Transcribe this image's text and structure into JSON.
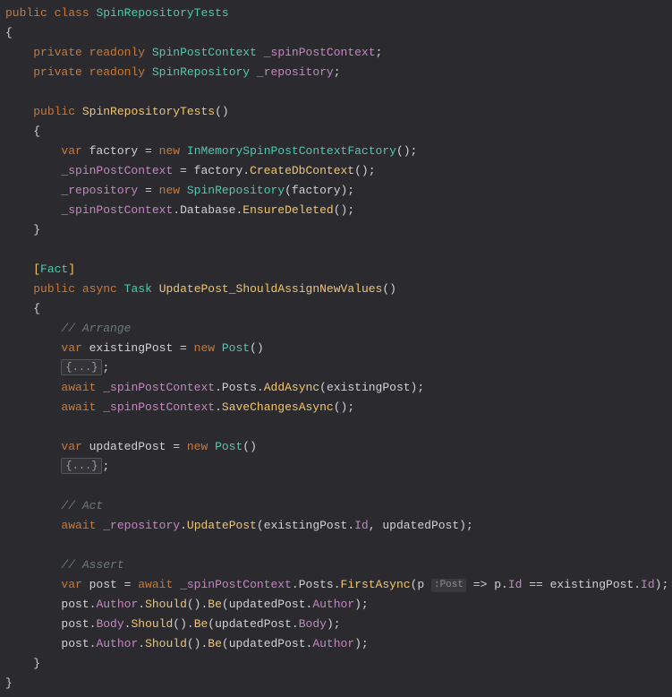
{
  "l1": {
    "kw1": "public",
    "kw2": "class",
    "name": "SpinRepositoryTests"
  },
  "l2": {
    "b": "{"
  },
  "l3": {
    "kw1": "private",
    "kw2": "readonly",
    "type": "SpinPostContext",
    "name": "_spinPostContext",
    "semi": ";"
  },
  "l4": {
    "kw1": "private",
    "kw2": "readonly",
    "type": "SpinRepository",
    "name": "_repository",
    "semi": ";"
  },
  "l5": {
    "kw": "public",
    "name": "SpinRepositoryTests",
    "paren": "()"
  },
  "l6": {
    "b": "{"
  },
  "l7": {
    "kw": "var",
    "name": " factory ",
    "eq": "=",
    "kwNew": "new",
    "type": "InMemorySpinPostContextFactory",
    "tail": "();"
  },
  "l8": {
    "fld": "_spinPostContext",
    "mid": " = factory.",
    "fn": "CreateDbContext",
    "tail": "();"
  },
  "l9": {
    "fld": "_repository",
    "mid": " = ",
    "kw": "new",
    "type": "SpinRepository",
    "tail": "(factory);"
  },
  "l10": {
    "fld": "_spinPostContext",
    "dot": ".",
    "m1": "Database",
    "dot2": ".",
    "fn": "EnsureDeleted",
    "tail": "();"
  },
  "l11": {
    "b": "}"
  },
  "l12": {
    "open": "[",
    "attr": "Fact",
    "close": "]"
  },
  "l13": {
    "kw1": "public",
    "kw2": "async",
    "type": "Task",
    "fn": "UpdatePost_ShouldAssignNewValues",
    "paren": "()"
  },
  "l14": {
    "b": "{"
  },
  "l15": {
    "c": "// Arrange"
  },
  "l16": {
    "kw": "var",
    "name": " existingPost ",
    "eq": "= ",
    "kwNew": "new",
    "type": "Post",
    "paren": "()"
  },
  "l17": {
    "fold": "{...}",
    "semi": ";"
  },
  "l18": {
    "kw": "await",
    "fld": "_spinPostContext",
    "dot": ".",
    "m": "Posts",
    "dot2": ".",
    "fn": "AddAsync",
    "tail": "(existingPost);"
  },
  "l19": {
    "kw": "await",
    "fld": "_spinPostContext",
    "dot": ".",
    "fn": "SaveChangesAsync",
    "tail": "();"
  },
  "l20": {
    "kw": "var",
    "name": " updatedPost ",
    "eq": "= ",
    "kwNew": "new",
    "type": "Post",
    "paren": "()"
  },
  "l21": {
    "fold": "{...}",
    "semi": ";"
  },
  "l22": {
    "c": "// Act"
  },
  "l23": {
    "kw": "await",
    "fld": "_repository",
    "dot": ".",
    "fn": "UpdatePost",
    "open": "(existingPost.",
    "m": "Id",
    "rest": ", updatedPost);"
  },
  "l24": {
    "c": "// Assert"
  },
  "l25": {
    "kw": "var",
    "name": " post = ",
    "kw2": "await",
    "fld": "_spinPostContext",
    "dot": ".",
    "m": "Posts",
    "dot2": ".",
    "fn": "FirstAsync",
    "open": "(p",
    "hint": ":Post",
    "rest1": " => p.",
    "pId": "Id",
    "rest2": " == existingPost.",
    "eId": "Id",
    "close": ");"
  },
  "l26": {
    "pre": "post.",
    "a": "Author",
    "dot": ".",
    "fn1": "Should",
    "paren": "().",
    "fn2": "Be",
    "open": "(updatedPost.",
    "b": "Author",
    "close": ");"
  },
  "l27": {
    "pre": "post.",
    "a": "Body",
    "dot": ".",
    "fn1": "Should",
    "paren": "().",
    "fn2": "Be",
    "open": "(updatedPost.",
    "b": "Body",
    "close": ");"
  },
  "l28": {
    "pre": "post.",
    "a": "Author",
    "dot": ".",
    "fn1": "Should",
    "paren": "().",
    "fn2": "Be",
    "open": "(updatedPost.",
    "b": "Author",
    "close": ");"
  },
  "l29": {
    "b": "}"
  },
  "l30": {
    "b": "}"
  }
}
